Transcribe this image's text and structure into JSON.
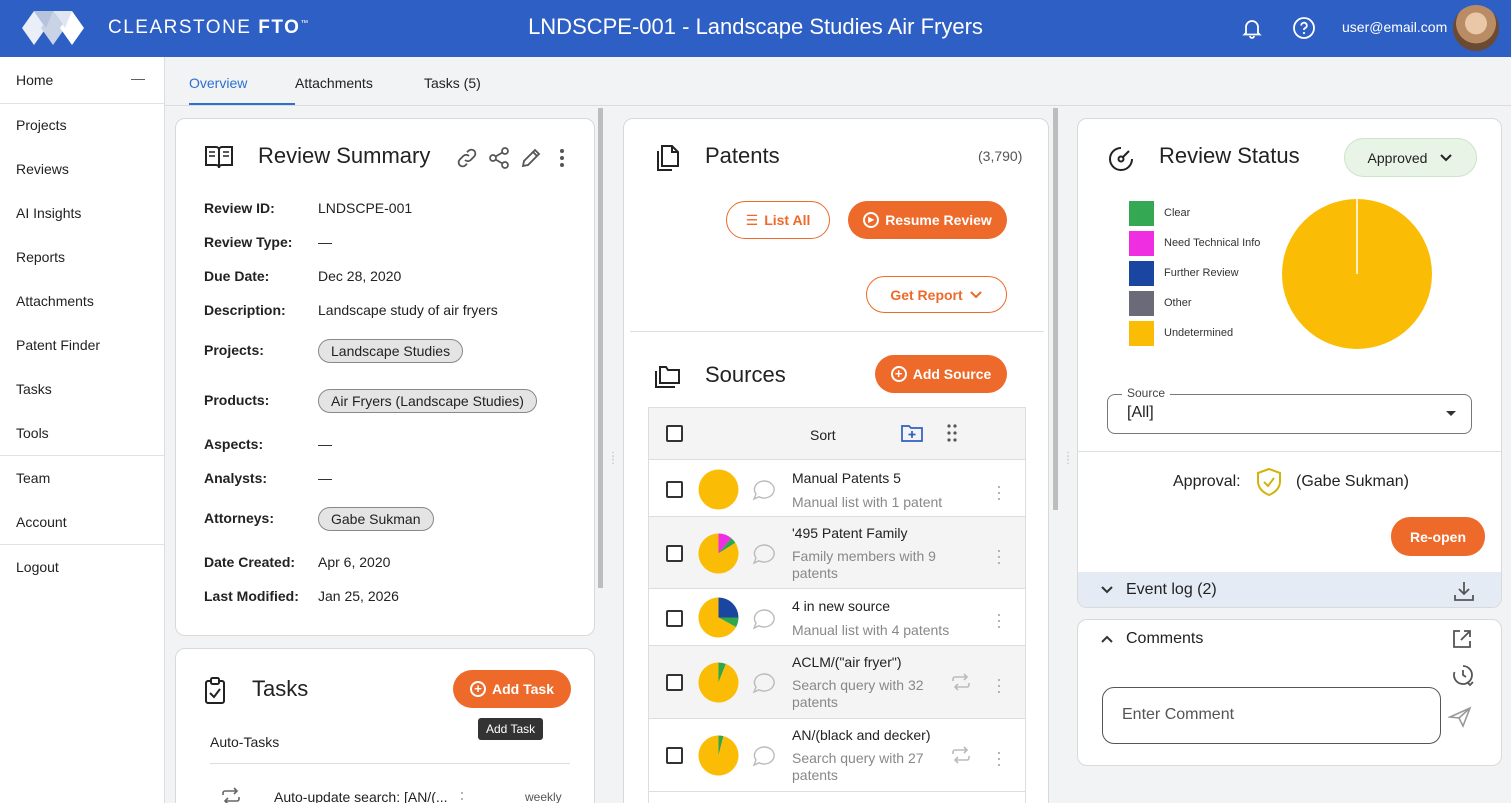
{
  "brand": {
    "name_light": "CLEARSTONE ",
    "name_bold": "FTO",
    "trademark": "™"
  },
  "header": {
    "title": "LNDSCPE-001 - Landscape Studies Air Fryers",
    "user_email": "user@email.com",
    "icons": [
      "bell-icon",
      "help-icon"
    ]
  },
  "sidebar": {
    "items": [
      {
        "label": "Home"
      },
      {
        "label": "Projects"
      },
      {
        "label": "Reviews"
      },
      {
        "label": "AI Insights"
      },
      {
        "label": "Reports"
      },
      {
        "label": "Attachments"
      },
      {
        "label": "Patent Finder"
      },
      {
        "label": "Tasks"
      },
      {
        "label": "Tools"
      },
      {
        "label": "Team"
      },
      {
        "label": "Account"
      },
      {
        "label": "Logout"
      }
    ],
    "collapse_symbol": "—"
  },
  "tabs": [
    {
      "label": "Overview"
    },
    {
      "label": "Attachments"
    },
    {
      "label": "Tasks (5)"
    }
  ],
  "review_summary": {
    "title": "Review Summary",
    "fields": {
      "review_id": {
        "label": "Review ID:",
        "value": "LNDSCPE-001"
      },
      "review_type": {
        "label": "Review Type:",
        "value": "—"
      },
      "due_date": {
        "label": "Due Date:",
        "value": "Dec 28, 2020"
      },
      "description": {
        "label": "Description:",
        "value": "Landscape study of air fryers"
      },
      "projects": {
        "label": "Projects:",
        "value": "Landscape Studies"
      },
      "products": {
        "label": "Products:",
        "value": "Air Fryers (Landscape Studies)"
      },
      "aspects": {
        "label": "Aspects:",
        "value": "—"
      },
      "analysts": {
        "label": "Analysts:",
        "value": "—"
      },
      "attorneys": {
        "label": "Attorneys:",
        "value": "Gabe Sukman"
      },
      "date_created": {
        "label": "Date Created:",
        "value": "Apr 6, 2020"
      },
      "last_modified": {
        "label": "Last Modified:",
        "value": "Jan 25, 2026"
      }
    }
  },
  "tasks": {
    "title": "Tasks",
    "add_label": "Add Task",
    "tooltip": "Add Task",
    "section": "Auto-Tasks",
    "items": [
      {
        "label": "Auto-update search: [AN/(...",
        "frequency": "weekly"
      }
    ]
  },
  "patents": {
    "title": "Patents",
    "count": "(3,790)",
    "list_all": "List All",
    "resume_review": "Resume Review",
    "get_report": "Get Report"
  },
  "sources": {
    "title": "Sources",
    "add_label": "Add Source",
    "sort_label": "Sort",
    "rows": [
      {
        "name": "Manual Patents 5",
        "desc": "Manual list with 1 patent",
        "pie": [
          {
            "value": 100,
            "color": "#fbbc05"
          }
        ]
      },
      {
        "name": "'495 Patent Family",
        "desc": "Family members with 9 patents",
        "pie": [
          {
            "value": 11,
            "color": "#ee2ee0"
          },
          {
            "value": 5,
            "color": "#2ea84a"
          },
          {
            "value": 84,
            "color": "#fbbc05"
          }
        ]
      },
      {
        "name": "4 in new source",
        "desc": "Manual list with 4 patents",
        "pie": [
          {
            "value": 25,
            "color": "#1a45a0"
          },
          {
            "value": 8,
            "color": "#2ea84a"
          },
          {
            "value": 67,
            "color": "#fbbc05"
          }
        ]
      },
      {
        "name": "ACLM/(\"air fryer\")",
        "desc": "Search query with 32 patents",
        "pie": [
          {
            "value": 6,
            "color": "#2ea84a"
          },
          {
            "value": 94,
            "color": "#fbbc05"
          }
        ]
      },
      {
        "name": "AN/(black and decker)",
        "desc": "Search query with 27 patents",
        "pie": [
          {
            "value": 4,
            "color": "#2ea84a"
          },
          {
            "value": 96,
            "color": "#fbbc05"
          }
        ]
      }
    ]
  },
  "review_status": {
    "title": "Review Status",
    "status": "Approved",
    "legend": [
      {
        "label": "Clear",
        "color": "#34a853"
      },
      {
        "label": "Need Technical Info",
        "color": "#ee2ee0"
      },
      {
        "label": "Further Review",
        "color": "#1a45a0"
      },
      {
        "label": "Other",
        "color": "#6a6a78"
      },
      {
        "label": "Undetermined",
        "color": "#fbbc05"
      }
    ],
    "source_label": "Source",
    "source_value": "[All]",
    "approval_label": "Approval:",
    "approver": "(Gabe Sukman)",
    "reopen": "Re-open",
    "event_log": "Event log (2)"
  },
  "comments": {
    "title": "Comments",
    "placeholder": "Enter Comment"
  },
  "chart_data": {
    "type": "pie",
    "categories": [
      "Clear",
      "Need Technical Info",
      "Further Review",
      "Other",
      "Undetermined"
    ],
    "values": [
      0,
      0,
      0,
      0,
      100
    ]
  }
}
